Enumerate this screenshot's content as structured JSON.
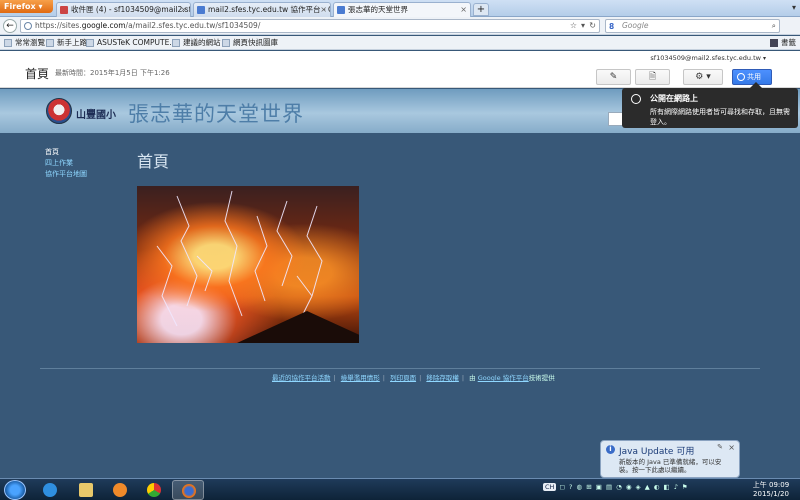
{
  "browser": {
    "menu_button": "Firefox",
    "tabs": [
      {
        "label": "收件匣 (4) - sf1034509@mail2.sfes...",
        "favicon_color": "#c44"
      },
      {
        "label": "mail2.sfes.tyc.edu.tw 協作平台 - Go...",
        "favicon_color": "#4a7bd1"
      },
      {
        "label": "張志華的天堂世界",
        "favicon_color": "#4a7bd1"
      }
    ],
    "new_tab": "+",
    "url_host_prefix": "https://sites.",
    "url_host": "google.com",
    "url_path": "/a/mail2.sfes.tyc.edu.tw/sf1034509/",
    "search_engine": "Google",
    "search_placeholder": "Google",
    "bookmarks": [
      "常常瀏覽",
      "新手上路",
      "ASUSTeK COMPUTE...",
      "建議的網站",
      "網頁快訊圖庫"
    ],
    "bookmarks_right": "書籤"
  },
  "sites_header": {
    "page_title": "首頁",
    "updated": "最新時間：2015年1月5日 下午1:26",
    "user_email": "sf1034509@mail2.sfes.tyc.edu.tw",
    "edit_icon": "pencil-icon",
    "new_page_icon": "new-page-icon",
    "settings_icon": "gear-icon",
    "share_label": "共用"
  },
  "banner": {
    "logo_text": "山豐國小",
    "site_name": "張志華的天堂世界"
  },
  "tooltip": {
    "title": "公開在網路上",
    "description": "所有網際網路使用者皆可尋找和存取，且無需登入。"
  },
  "sidebar": {
    "items": [
      {
        "label": "首頁",
        "active": true
      },
      {
        "label": "四上作業",
        "active": false
      },
      {
        "label": "協作平台地圖",
        "active": false
      }
    ]
  },
  "main": {
    "heading": "首頁",
    "image_alt": "volcanic-lightning-photo"
  },
  "footer": {
    "links": [
      "最近的協作平台活動",
      "檢舉濫用情形",
      "列印頁面",
      "移除存取權"
    ],
    "powered_prefix": "由",
    "powered_brand": "Google 協作平台",
    "powered_suffix": "技術提供"
  },
  "java_popup": {
    "title": "Java Update 可用",
    "description": "新版本的 Java 已準備就緒，可以安裝。按一下此處以繼續。"
  },
  "taskbar": {
    "language": "CH",
    "time": "上午 09:09",
    "date": "2015/1/20"
  },
  "colors": {
    "page_bg": "#385878",
    "link": "#8fd7ff",
    "share_button": "#4d90fe",
    "firefox_button": "#e06a12"
  }
}
